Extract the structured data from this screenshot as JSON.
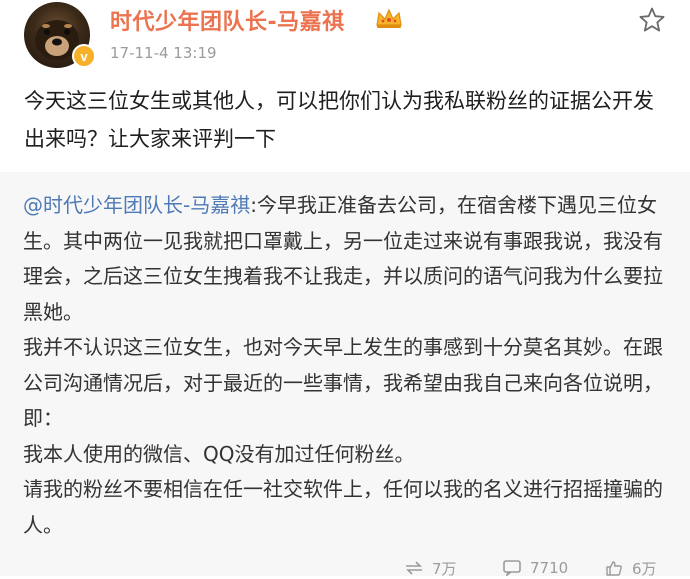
{
  "user": {
    "name": "时代少年团队长-马嘉祺",
    "verified_badge": "v",
    "timestamp": "17-11-4 13:19"
  },
  "post": {
    "text": "今天这三位女生或其他人，可以把你们认为我私联粉丝的证据公开发出来吗？让大家来评判一下"
  },
  "repost": {
    "mention": "@时代少年团队长-马嘉祺",
    "paragraph1": ":今早我正准备去公司，在宿舍楼下遇见三位女生。其中两位一见我就把口罩戴上，另一位走过来说有事跟我说，我没有理会，之后这三位女生拽着我不让我走，并以质问的语气问我为什么要拉黑她。",
    "paragraph2": "我并不认识这三位女生，也对今天早上发生的事感到十分莫名其妙。在跟公司沟通情况后，对于最近的一些事情，我希望由我自己来向各位说明，即：",
    "paragraph3": "我本人使用的微信、QQ没有加过任何粉丝。",
    "paragraph4": "请我的粉丝不要相信在任一社交软件上，任何以我的名义进行招摇撞骗的人。"
  },
  "actions": {
    "repost_count": "7万",
    "comment_count": "7710",
    "like_count": "6万"
  },
  "colors": {
    "username": "#eb7350",
    "mention": "#4e7ab6",
    "repost_background": "#f7f7f7"
  },
  "icons": [
    "avatar-dog",
    "verified-badge",
    "crown-icon",
    "star-icon",
    "repost-icon",
    "comment-icon",
    "like-icon"
  ]
}
